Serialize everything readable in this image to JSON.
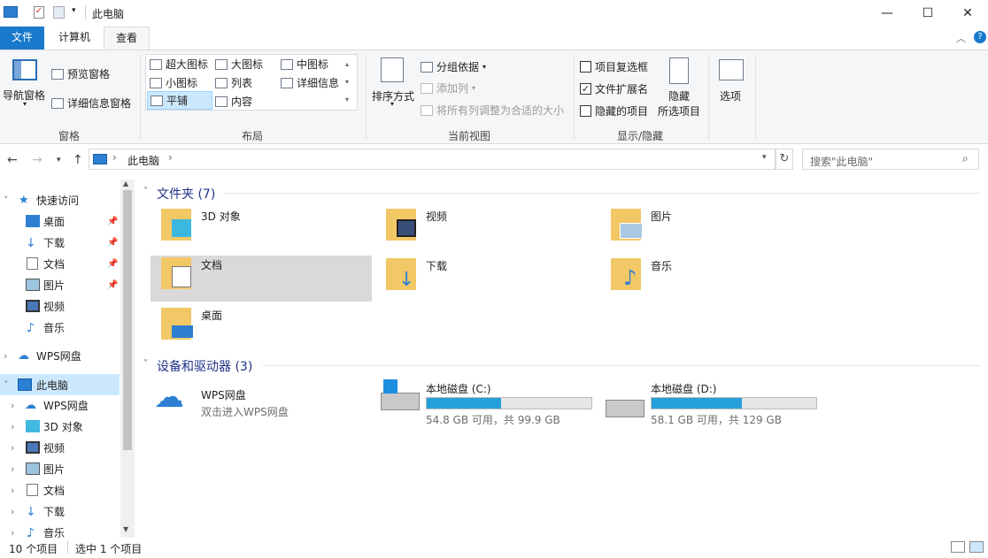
{
  "window": {
    "title": "此电脑"
  },
  "window_controls": {
    "minimize": "—",
    "maximize": "☐",
    "close": "✕"
  },
  "tabs": [
    {
      "label": "文件"
    },
    {
      "label": "计算机"
    },
    {
      "label": "查看"
    }
  ],
  "ribbon": {
    "panes": {
      "nav_pane": "导航窗格",
      "preview_pane": "预览窗格",
      "details_pane": "详细信息窗格",
      "group_label": "窗格"
    },
    "layout": {
      "items": [
        "超大图标",
        "大图标",
        "中图标",
        "小图标",
        "列表",
        "详细信息",
        "平铺",
        "内容"
      ],
      "group_label": "布局",
      "selected": "平铺"
    },
    "current_view": {
      "sort_by": "排序方式",
      "group_by": "分组依据",
      "add_column": "添加列",
      "fit_columns": "将所有列调整为合适的大小",
      "group_label": "当前视图"
    },
    "show_hide": {
      "item_checkboxes": "项目复选框",
      "file_extensions": "文件扩展名",
      "hidden_items": "隐藏的项目",
      "hide_selected": "隐藏",
      "hide_selected2": "所选项目",
      "group_label": "显示/隐藏",
      "checked": {
        "item_checkboxes": false,
        "file_extensions": true,
        "hidden_items": false
      }
    },
    "options": "选项"
  },
  "address": {
    "path": "此电脑",
    "search_placeholder": "搜索\"此电脑\""
  },
  "nav": {
    "items": [
      {
        "label": "快速访问"
      },
      {
        "label": "桌面"
      },
      {
        "label": "下载"
      },
      {
        "label": "文档"
      },
      {
        "label": "图片"
      },
      {
        "label": "视频"
      },
      {
        "label": "音乐"
      },
      {
        "label": "WPS网盘"
      },
      {
        "label": "此电脑"
      },
      {
        "label": "WPS网盘"
      },
      {
        "label": "3D 对象"
      },
      {
        "label": "视频"
      },
      {
        "label": "图片"
      },
      {
        "label": "文档"
      },
      {
        "label": "下载"
      },
      {
        "label": "音乐"
      }
    ]
  },
  "content": {
    "folders_header": "文件夹 (7)",
    "folders": [
      {
        "name": "3D 对象"
      },
      {
        "name": "视频"
      },
      {
        "name": "图片"
      },
      {
        "name": "文档"
      },
      {
        "name": "下载"
      },
      {
        "name": "音乐"
      },
      {
        "name": "桌面"
      }
    ],
    "devices_header": "设备和驱动器 (3)",
    "wps": {
      "name": "WPS网盘",
      "subtitle": "双击进入WPS网盘"
    },
    "drives": [
      {
        "name": "本地磁盘 (C:)",
        "space": "54.8 GB 可用，共 99.9 GB",
        "used_fraction": 0.45
      },
      {
        "name": "本地磁盘 (D:)",
        "space": "58.1 GB 可用，共 129 GB",
        "used_fraction": 0.55
      }
    ]
  },
  "status": {
    "count": "10 个项目",
    "selected": "选中 1 个项目"
  },
  "colors": {
    "accent": "#1979ca",
    "selection": "#d9d9d9",
    "nav_selected": "#cce8ff",
    "bar_fill": "#26a0da"
  }
}
